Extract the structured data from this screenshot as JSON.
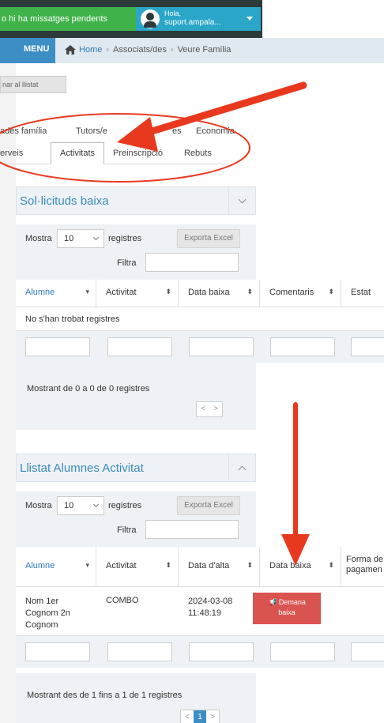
{
  "topbar": {
    "messages": "o hi ha missatges pendents",
    "greeting": "Hola,",
    "username": "suport.ampala..."
  },
  "nav": {
    "menu_label": "MENU",
    "breadcrumb": {
      "home": "Home",
      "section": "Associats/des",
      "page": "Veure Família"
    }
  },
  "back_button": "nar al llistat",
  "tabs": {
    "row1": [
      "ades família",
      "Tutors/e",
      "es",
      "Economia"
    ],
    "row2": [
      "erveis",
      "Activitats",
      "Preinscripció",
      "Rebuts"
    ],
    "active": "Activitats"
  },
  "panel1": {
    "title": "Sol·licituds baixa",
    "show_label": "Mostra",
    "page_size": "10",
    "records_label": "registres",
    "export_label": "Exporta Excel",
    "filter_label": "Filtra",
    "columns": [
      "Alumne",
      "Activitat",
      "Data baixa",
      "Comentaris",
      "Estat"
    ],
    "empty_message": "No s'han trobat registres",
    "footer": "Mostrant de 0 a 0 de 0 registres"
  },
  "panel2": {
    "title": "Llistat Alumnes Activitat",
    "show_label": "Mostra",
    "page_size": "10",
    "records_label": "registres",
    "export_label": "Exporta Excel",
    "filter_label": "Filtra",
    "columns": [
      "Alumne",
      "Activitat",
      "Data d'alta",
      "Data baixa",
      "Forma de",
      "pagamen"
    ],
    "rows": [
      {
        "alumne": [
          "Nom 1er",
          "Cognom 2n",
          "Cognom"
        ],
        "activitat": "COMBO",
        "data_alta": [
          "2024-03-08",
          "11:48:19"
        ],
        "action": [
          "Demana",
          "baixa"
        ]
      }
    ],
    "footer": "Mostrant des de 1 fins a 1 de 1 registres",
    "current_page": "1"
  },
  "pager": {
    "prev": "<",
    "next": ">"
  },
  "sort_glyph": "⬍",
  "dropdown_glyph": "▾",
  "colors": {
    "accent": "#3d8ec4",
    "danger": "#d9534f",
    "annotation_arrow": "#e8391f",
    "success": "#3fb249"
  }
}
